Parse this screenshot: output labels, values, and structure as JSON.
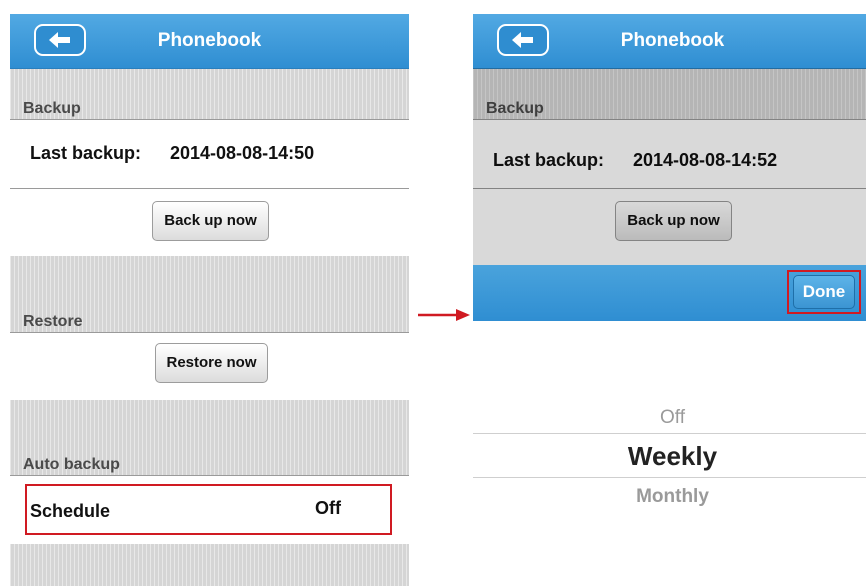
{
  "left_screen": {
    "nav": {
      "title": "Phonebook",
      "back_icon": "arrow-left-icon"
    },
    "backup_section": {
      "label": "Backup"
    },
    "last_backup": {
      "label": "Last backup:",
      "value": "2014-08-08-14:50"
    },
    "backup_button": "Back up now",
    "restore_section": {
      "label": "Restore"
    },
    "restore_button": "Restore now",
    "auto_backup_section": {
      "label": "Auto backup"
    },
    "schedule": {
      "label": "Schedule",
      "value": "Off"
    }
  },
  "right_screen": {
    "nav": {
      "title": "Phonebook",
      "back_icon": "arrow-left-icon"
    },
    "backup_section": {
      "label": "Backup"
    },
    "last_backup": {
      "label": "Last backup:",
      "value": "2014-08-08-14:52"
    },
    "backup_button": "Back up now",
    "toolbar": {
      "done_label": "Done"
    },
    "picker": {
      "options": [
        "Off",
        "Weekly",
        "Monthly"
      ],
      "selected": "Weekly"
    }
  },
  "colors": {
    "nav_blue": "#3a9ad9",
    "highlight_red": "#d01a22",
    "section_gray": "#d5d5d5"
  }
}
